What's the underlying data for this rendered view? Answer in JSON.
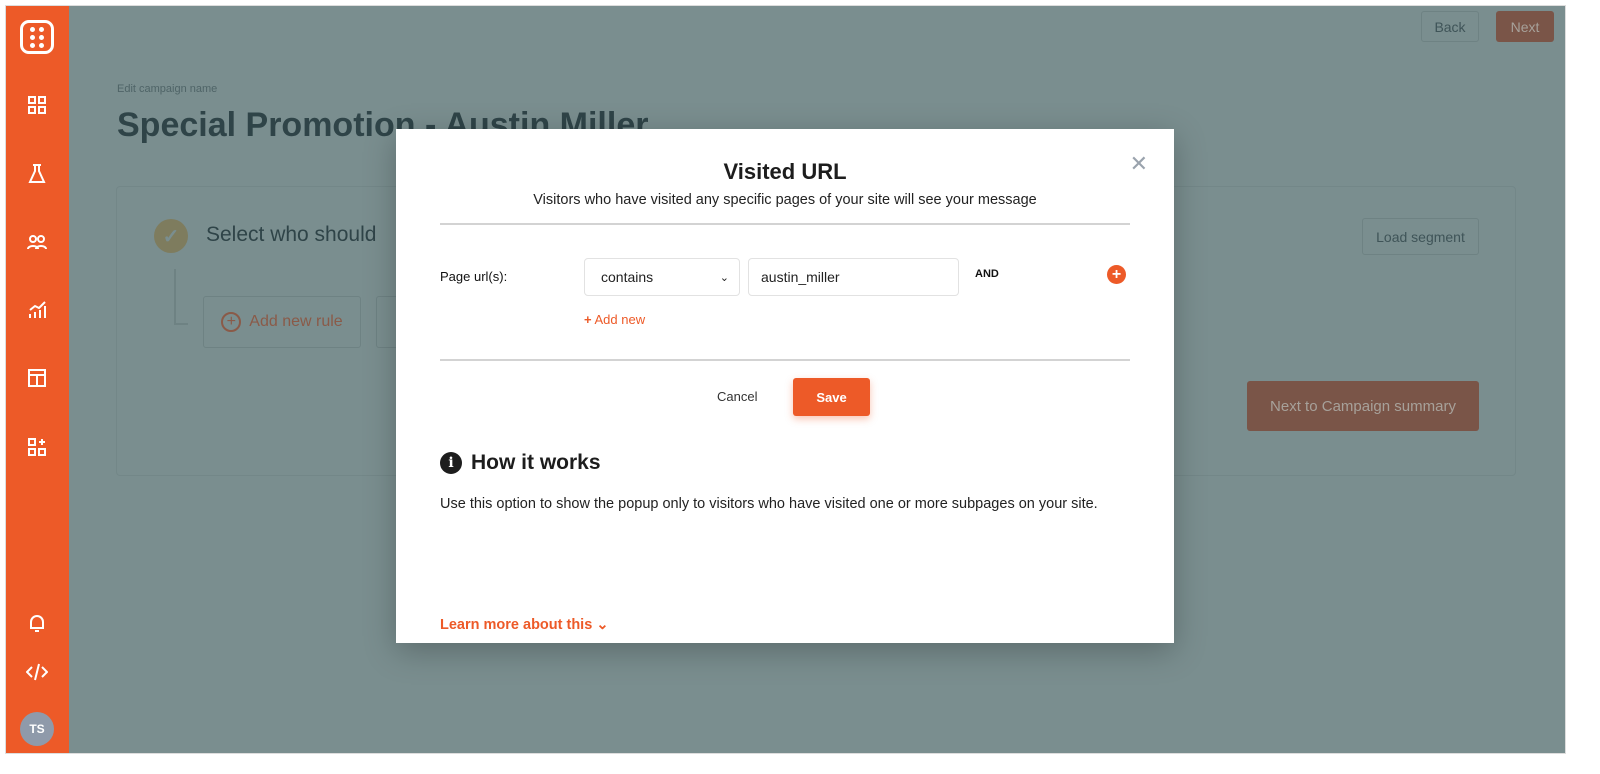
{
  "sidebar": {
    "items": [
      "dashboard-icon",
      "flask-icon",
      "users-icon",
      "analytics-icon",
      "layout-icon",
      "add-widget-icon",
      "bell-icon",
      "code-icon"
    ],
    "avatar": "TS"
  },
  "header": {
    "back": "Back",
    "next": "Next"
  },
  "campaign": {
    "edit_label": "Edit campaign name",
    "title": "Special Promotion - Austin Miller",
    "step_title": "Select who should",
    "add_rule": "Add new rule",
    "load_segment": "Load segment",
    "next_summary": "Next to Campaign summary"
  },
  "modal": {
    "title": "Visited URL",
    "subtitle": "Visitors who have visited any specific pages of your site will see your message",
    "label": "Page url(s):",
    "operator": "contains",
    "value": "austin_miller",
    "and": "AND",
    "add_new": "Add new",
    "cancel": "Cancel",
    "save": "Save",
    "how_title": "How it works",
    "how_text": "Use this option to show the popup only to visitors who have visited one or more subpages on your site.",
    "learn_more": "Learn more about this"
  },
  "colors": {
    "accent": "#ed5a28",
    "overlay": "#7a8e8f"
  }
}
